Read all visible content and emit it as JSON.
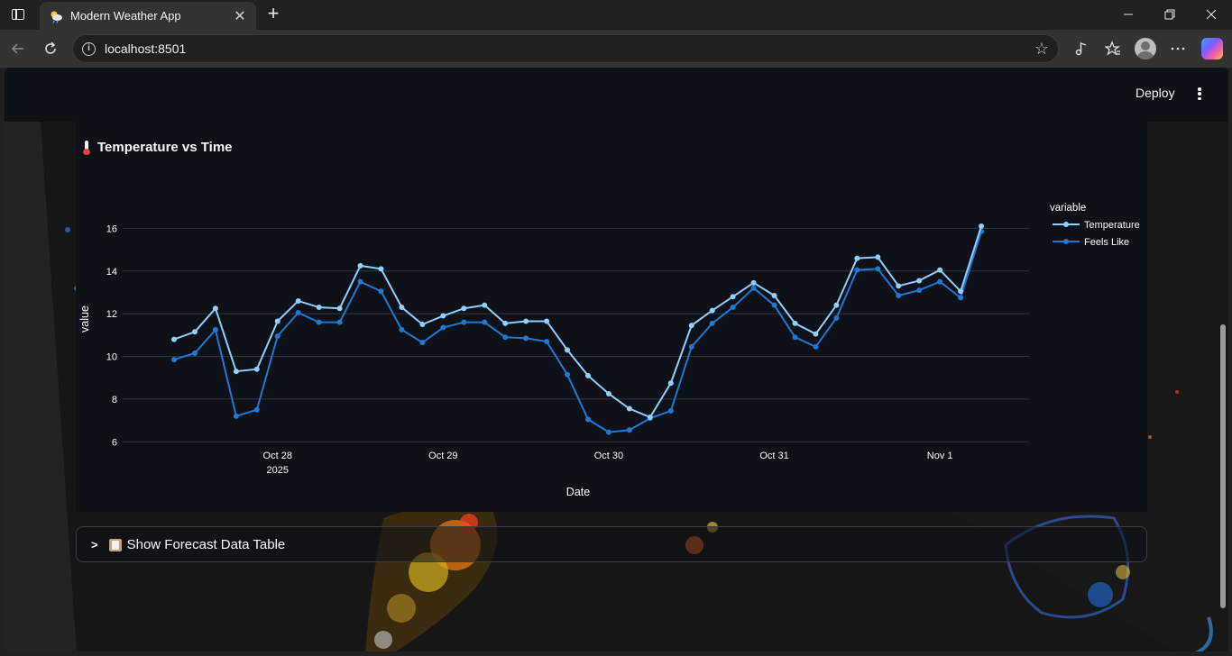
{
  "browser": {
    "tab_title": "Modern Weather App",
    "url": "localhost:8501",
    "icons": [
      "sidebar-toggle-icon",
      "weather-favicon-icon",
      "close-icon",
      "plus-icon",
      "minimize-icon",
      "restore-icon",
      "window-close-icon",
      "back-icon",
      "reload-icon",
      "info-icon",
      "star-icon",
      "read-aloud-icon",
      "favorites-icon",
      "profile-icon",
      "more-icon",
      "copilot-icon"
    ]
  },
  "app": {
    "deploy_label": "Deploy",
    "chart_heading": "Temperature vs Time",
    "expander_label": "Show Forecast Data Table",
    "colors": {
      "background": "#0e1117",
      "temperature": "#8fd0ff",
      "feels_like": "#1f78d1",
      "grid": "#31333f"
    }
  },
  "chart_data": {
    "type": "line",
    "xlabel": "Date",
    "ylabel": "value",
    "legend_title": "variable",
    "legend_position": "top-right",
    "grid": true,
    "ylim": [
      5.8,
      17.2
    ],
    "yticks": [
      6,
      8,
      10,
      12,
      14,
      16
    ],
    "xticks": [
      {
        "label": "Oct 28",
        "sublabel": "2025",
        "index": 5
      },
      {
        "label": "Oct 29",
        "sublabel": "",
        "index": 13
      },
      {
        "label": "Oct 30",
        "sublabel": "",
        "index": 21
      },
      {
        "label": "Oct 31",
        "sublabel": "",
        "index": 29
      },
      {
        "label": "Nov 1",
        "sublabel": "",
        "index": 37
      }
    ],
    "x": [
      "2025-10-27 09:00",
      "2025-10-27 12:00",
      "2025-10-27 15:00",
      "2025-10-27 18:00",
      "2025-10-27 21:00",
      "2025-10-28 00:00",
      "2025-10-28 03:00",
      "2025-10-28 06:00",
      "2025-10-28 09:00",
      "2025-10-28 12:00",
      "2025-10-28 15:00",
      "2025-10-28 18:00",
      "2025-10-28 21:00",
      "2025-10-29 00:00",
      "2025-10-29 03:00",
      "2025-10-29 06:00",
      "2025-10-29 09:00",
      "2025-10-29 12:00",
      "2025-10-29 15:00",
      "2025-10-29 18:00",
      "2025-10-29 21:00",
      "2025-10-30 00:00",
      "2025-10-30 03:00",
      "2025-10-30 06:00",
      "2025-10-30 09:00",
      "2025-10-30 12:00",
      "2025-10-30 15:00",
      "2025-10-30 18:00",
      "2025-10-30 21:00",
      "2025-10-31 00:00",
      "2025-10-31 03:00",
      "2025-10-31 06:00",
      "2025-10-31 09:00",
      "2025-10-31 12:00",
      "2025-10-31 15:00",
      "2025-10-31 18:00",
      "2025-10-31 21:00",
      "2025-11-01 00:00",
      "2025-11-01 03:00",
      "2025-11-01 06:00",
      "2025-11-01 09:00"
    ],
    "series": [
      {
        "name": "Temperature",
        "color": "#8fd0ff",
        "values": [
          10.8,
          11.15,
          12.25,
          9.3,
          9.4,
          11.65,
          12.6,
          12.3,
          12.25,
          14.25,
          14.1,
          12.3,
          11.5,
          11.9,
          12.25,
          12.4,
          11.55,
          11.65,
          11.65,
          10.3,
          9.1,
          8.25,
          7.55,
          7.15,
          8.75,
          11.45,
          12.15,
          12.8,
          13.45,
          12.85,
          11.55,
          11.05,
          12.4,
          14.6,
          14.65,
          13.3,
          13.55,
          14.05,
          13.05,
          16.1
        ]
      },
      {
        "name": "Feels Like",
        "color": "#1f78d1",
        "values": [
          9.85,
          10.15,
          11.25,
          7.2,
          7.5,
          10.95,
          12.05,
          11.6,
          11.6,
          13.5,
          13.05,
          11.25,
          10.65,
          11.35,
          11.6,
          11.6,
          10.9,
          10.85,
          10.7,
          9.15,
          7.05,
          6.45,
          6.55,
          7.1,
          7.45,
          10.45,
          11.55,
          12.3,
          13.2,
          12.4,
          10.9,
          10.45,
          11.8,
          14.05,
          14.1,
          12.85,
          13.1,
          13.5,
          12.75,
          15.85
        ]
      }
    ]
  }
}
